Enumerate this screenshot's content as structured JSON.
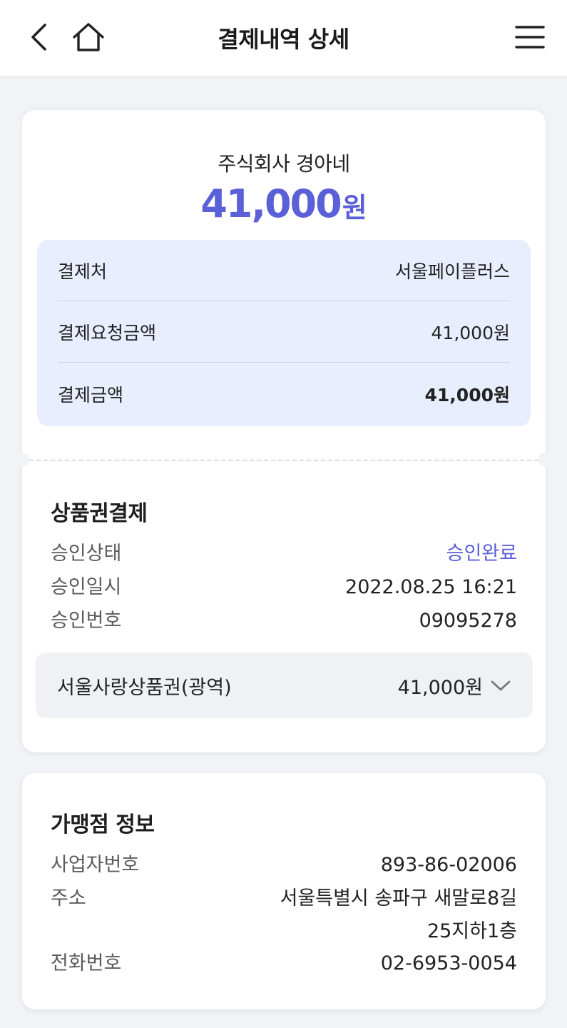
{
  "header": {
    "title": "결제내역 상세"
  },
  "receipt": {
    "merchant": "주식회사 경아네",
    "amount_number": "41,000",
    "amount_unit": "원",
    "summary": [
      {
        "label": "결제처",
        "value": "서울페이플러스",
        "bold": false
      },
      {
        "label": "결제요청금액",
        "value": "41,000원",
        "bold": false
      },
      {
        "label": "결제금액",
        "value": "41,000원",
        "bold": true
      }
    ]
  },
  "voucher_payment": {
    "title": "상품권결제",
    "rows": [
      {
        "label": "승인상태",
        "value": "승인완료"
      },
      {
        "label": "승인일시",
        "value": "2022.08.25 16:21"
      },
      {
        "label": "승인번호",
        "value": "09095278"
      }
    ],
    "voucher": {
      "name": "서울사랑상품권(광역)",
      "amount": "41,000원"
    }
  },
  "merchant_info": {
    "title": "가맹점 정보",
    "rows": [
      {
        "label": "사업자번호",
        "value": "893-86-02006"
      },
      {
        "label": "주소",
        "value_line1": "서울특별시 송파구 새말로8길",
        "value_line2": "25지하1층"
      },
      {
        "label": "전화번호",
        "value": "02-6953-0054"
      }
    ]
  },
  "colors": {
    "accent": "#5b5fd8",
    "summary_bg": "#e8eefd",
    "page_bg": "#f1f3f6"
  },
  "icons": {
    "back": "chevron-left-icon",
    "home": "home-icon",
    "menu": "hamburger-menu-icon",
    "expand": "chevron-down-icon"
  }
}
